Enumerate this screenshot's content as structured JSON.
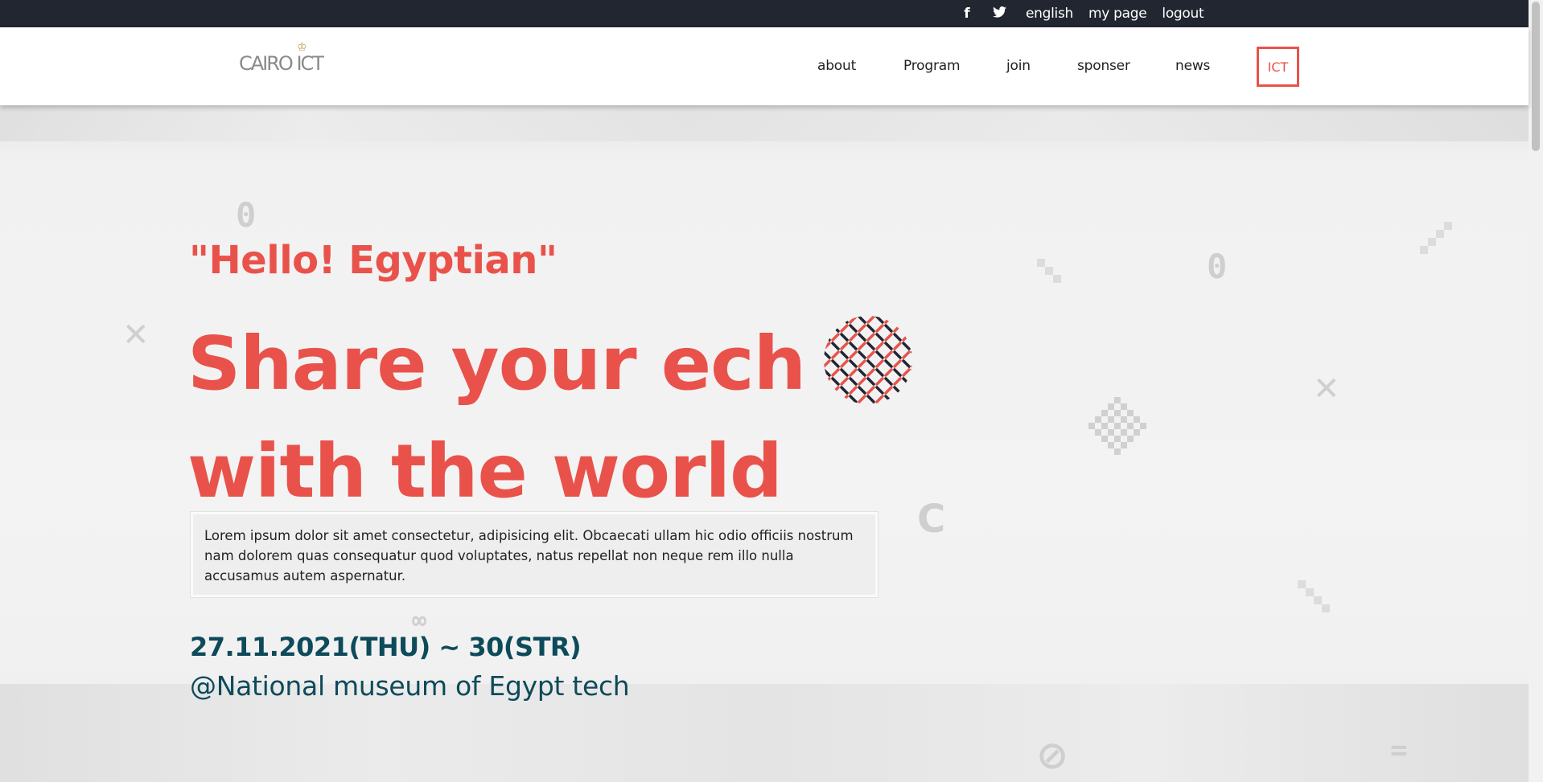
{
  "topbar": {
    "social": {
      "facebook_glyph": "f",
      "twitter_glyph": "🐦"
    },
    "links": {
      "language": "english",
      "my_page": "my page",
      "logout": "logout"
    }
  },
  "header": {
    "logo_text": "CAIRO ICT",
    "nav": [
      "about",
      "Program",
      "join",
      "sponser",
      "news"
    ],
    "ict_button": "ICT"
  },
  "hero": {
    "quote": "\"Hello! Egyptian\"",
    "headline_line1": "Share your ech",
    "headline_line2": "with the world",
    "description": "Lorem ipsum dolor sit amet consectetur, adipisicing elit. Obcaecati ullam hic odio officiis nostrum nam dolorem quas consequatur quod voluptates, natus repellat non neque rem illo nulla accusamus autem aspernatur.",
    "date": "27.11.2021(THU) ~ 30(STR)",
    "venue": "@National museum of Egypt tech"
  },
  "colors": {
    "accent": "#e9524a",
    "dark_bar": "#222631",
    "teal_text": "#0d4a5a"
  },
  "icons": [
    "facebook-icon",
    "twitter-icon"
  ]
}
